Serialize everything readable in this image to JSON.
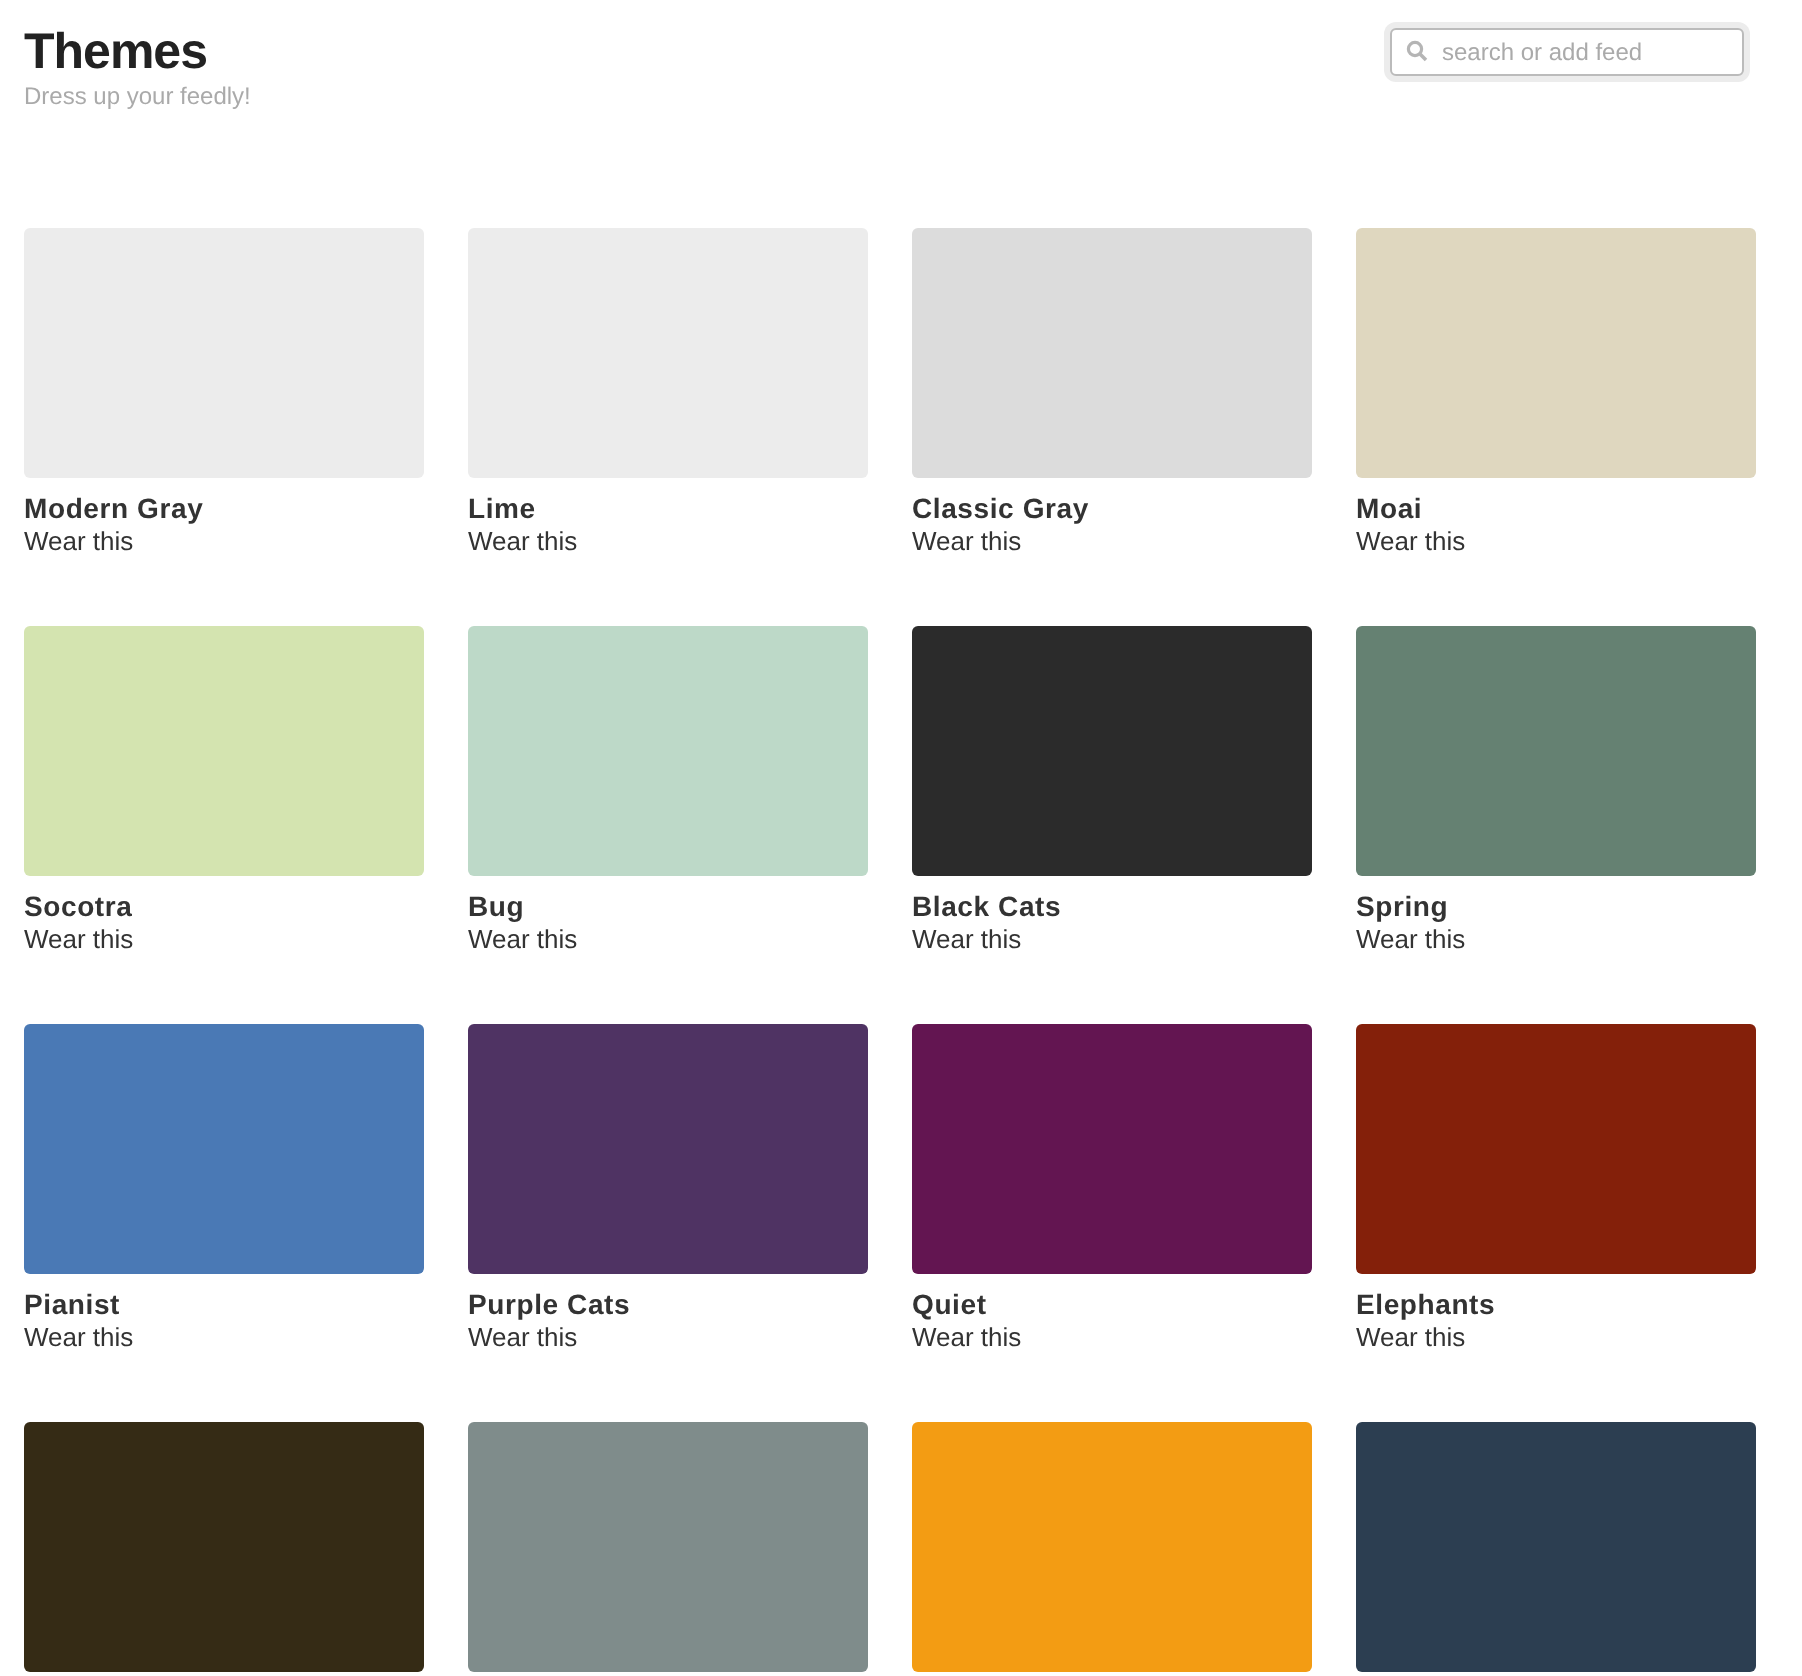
{
  "header": {
    "title": "Themes",
    "subtitle": "Dress up your feedly!"
  },
  "search": {
    "placeholder": "search or add feed"
  },
  "themes": [
    {
      "name": "Modern Gray",
      "action": "Wear this",
      "color": "#ececec"
    },
    {
      "name": "Lime",
      "action": "Wear this",
      "color": "#ececec"
    },
    {
      "name": "Classic Gray",
      "action": "Wear this",
      "color": "#dcdcdc"
    },
    {
      "name": "Moai",
      "action": "Wear this",
      "color": "#dfd7bf"
    },
    {
      "name": "Socotra",
      "action": "Wear this",
      "color": "#d4e4b0"
    },
    {
      "name": "Bug",
      "action": "Wear this",
      "color": "#bdd9c8"
    },
    {
      "name": "Black Cats",
      "action": "Wear this",
      "color": "#2b2b2b"
    },
    {
      "name": "Spring",
      "action": "Wear this",
      "color": "#658172"
    },
    {
      "name": "Pianist",
      "action": "Wear this",
      "color": "#4a79b5"
    },
    {
      "name": "Purple Cats",
      "action": "Wear this",
      "color": "#4f3363"
    },
    {
      "name": "Quiet",
      "action": "Wear this",
      "color": "#631551"
    },
    {
      "name": "Elephants",
      "action": "Wear this",
      "color": "#84200a"
    },
    {
      "color": "#352b15"
    },
    {
      "color": "#7f8c8b"
    },
    {
      "color": "#f39c13"
    },
    {
      "color": "#2c3e51"
    }
  ]
}
